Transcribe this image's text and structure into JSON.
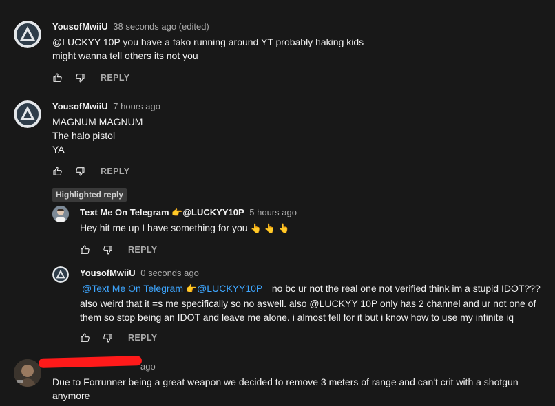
{
  "colors": {
    "background": "#181818",
    "text": "#f1f1f1",
    "secondary": "#aaaaaa",
    "link": "#3ea6ff",
    "redaction": "#ff1a1a"
  },
  "comments": [
    {
      "author": "YousofMwiiU",
      "time": "38 seconds ago (edited)",
      "avatar_icon": "triangle-logo-icon",
      "lines": [
        "@LUCKYY 10P you have a fako running around YT probably haking kids",
        "might wanna tell others its not you"
      ],
      "reply_label": "REPLY"
    },
    {
      "author": "YousofMwiiU",
      "time": "7 hours ago",
      "avatar_icon": "triangle-logo-icon",
      "lines": [
        "MAGNUM MAGNUM",
        "The halo pistol",
        "YA"
      ],
      "reply_label": "REPLY"
    }
  ],
  "highlighted_label": "Highlighted reply",
  "replies": [
    {
      "author": "Text Me On Telegram",
      "author_emoji": "👉",
      "mention": "@LUCKYY10P",
      "time": "5 hours ago",
      "avatar_icon": "person-photo-icon",
      "text": "Hey hit me up I have something for you",
      "emojis": "👆 👆 👆",
      "reply_label": "REPLY"
    },
    {
      "author": "YousofMwiiU",
      "time": "0 seconds ago",
      "avatar_icon": "triangle-logo-icon",
      "link1": "@Text Me On Telegram",
      "link_emoji": "👉",
      "link2": "@LUCKYY10P",
      "line1_rest": "no bc ur not the real one not verified think im a stupid IDOT???",
      "line2": "also weird that it =s me specifically so no aswell. also @LUCKYY 10P only has 2 channel and ur not one of",
      "line3": "them so stop being an IDOT and leave me alone. i almost fell for it but i know how to use my infinite iq",
      "reply_label": "REPLY"
    }
  ],
  "last_comment": {
    "time": "ago",
    "avatar_icon": "person-photo-icon",
    "lines": [
      "Due to Forrunner being a great weapon we decided to remove 3 meters of range and can't crit with a shotgun",
      "anymore"
    ]
  }
}
